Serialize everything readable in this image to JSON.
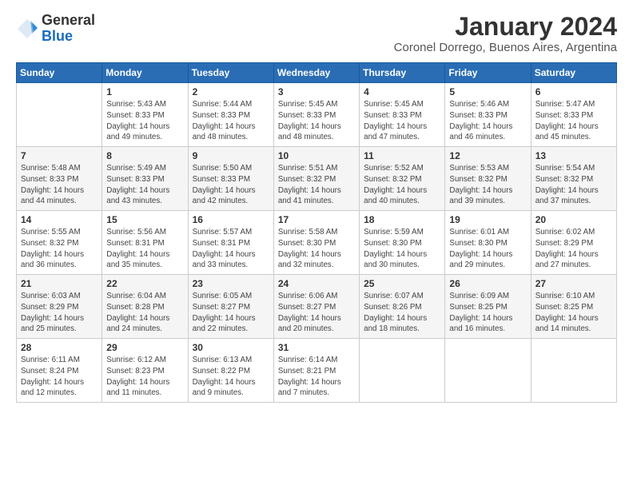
{
  "logo": {
    "general": "General",
    "blue": "Blue"
  },
  "title": "January 2024",
  "subtitle": "Coronel Dorrego, Buenos Aires, Argentina",
  "days_of_week": [
    "Sunday",
    "Monday",
    "Tuesday",
    "Wednesday",
    "Thursday",
    "Friday",
    "Saturday"
  ],
  "weeks": [
    [
      {
        "day": "",
        "info": ""
      },
      {
        "day": "1",
        "info": "Sunrise: 5:43 AM\nSunset: 8:33 PM\nDaylight: 14 hours\nand 49 minutes."
      },
      {
        "day": "2",
        "info": "Sunrise: 5:44 AM\nSunset: 8:33 PM\nDaylight: 14 hours\nand 48 minutes."
      },
      {
        "day": "3",
        "info": "Sunrise: 5:45 AM\nSunset: 8:33 PM\nDaylight: 14 hours\nand 48 minutes."
      },
      {
        "day": "4",
        "info": "Sunrise: 5:45 AM\nSunset: 8:33 PM\nDaylight: 14 hours\nand 47 minutes."
      },
      {
        "day": "5",
        "info": "Sunrise: 5:46 AM\nSunset: 8:33 PM\nDaylight: 14 hours\nand 46 minutes."
      },
      {
        "day": "6",
        "info": "Sunrise: 5:47 AM\nSunset: 8:33 PM\nDaylight: 14 hours\nand 45 minutes."
      }
    ],
    [
      {
        "day": "7",
        "info": "Sunrise: 5:48 AM\nSunset: 8:33 PM\nDaylight: 14 hours\nand 44 minutes."
      },
      {
        "day": "8",
        "info": "Sunrise: 5:49 AM\nSunset: 8:33 PM\nDaylight: 14 hours\nand 43 minutes."
      },
      {
        "day": "9",
        "info": "Sunrise: 5:50 AM\nSunset: 8:33 PM\nDaylight: 14 hours\nand 42 minutes."
      },
      {
        "day": "10",
        "info": "Sunrise: 5:51 AM\nSunset: 8:32 PM\nDaylight: 14 hours\nand 41 minutes."
      },
      {
        "day": "11",
        "info": "Sunrise: 5:52 AM\nSunset: 8:32 PM\nDaylight: 14 hours\nand 40 minutes."
      },
      {
        "day": "12",
        "info": "Sunrise: 5:53 AM\nSunset: 8:32 PM\nDaylight: 14 hours\nand 39 minutes."
      },
      {
        "day": "13",
        "info": "Sunrise: 5:54 AM\nSunset: 8:32 PM\nDaylight: 14 hours\nand 37 minutes."
      }
    ],
    [
      {
        "day": "14",
        "info": "Sunrise: 5:55 AM\nSunset: 8:32 PM\nDaylight: 14 hours\nand 36 minutes."
      },
      {
        "day": "15",
        "info": "Sunrise: 5:56 AM\nSunset: 8:31 PM\nDaylight: 14 hours\nand 35 minutes."
      },
      {
        "day": "16",
        "info": "Sunrise: 5:57 AM\nSunset: 8:31 PM\nDaylight: 14 hours\nand 33 minutes."
      },
      {
        "day": "17",
        "info": "Sunrise: 5:58 AM\nSunset: 8:30 PM\nDaylight: 14 hours\nand 32 minutes."
      },
      {
        "day": "18",
        "info": "Sunrise: 5:59 AM\nSunset: 8:30 PM\nDaylight: 14 hours\nand 30 minutes."
      },
      {
        "day": "19",
        "info": "Sunrise: 6:01 AM\nSunset: 8:30 PM\nDaylight: 14 hours\nand 29 minutes."
      },
      {
        "day": "20",
        "info": "Sunrise: 6:02 AM\nSunset: 8:29 PM\nDaylight: 14 hours\nand 27 minutes."
      }
    ],
    [
      {
        "day": "21",
        "info": "Sunrise: 6:03 AM\nSunset: 8:29 PM\nDaylight: 14 hours\nand 25 minutes."
      },
      {
        "day": "22",
        "info": "Sunrise: 6:04 AM\nSunset: 8:28 PM\nDaylight: 14 hours\nand 24 minutes."
      },
      {
        "day": "23",
        "info": "Sunrise: 6:05 AM\nSunset: 8:27 PM\nDaylight: 14 hours\nand 22 minutes."
      },
      {
        "day": "24",
        "info": "Sunrise: 6:06 AM\nSunset: 8:27 PM\nDaylight: 14 hours\nand 20 minutes."
      },
      {
        "day": "25",
        "info": "Sunrise: 6:07 AM\nSunset: 8:26 PM\nDaylight: 14 hours\nand 18 minutes."
      },
      {
        "day": "26",
        "info": "Sunrise: 6:09 AM\nSunset: 8:25 PM\nDaylight: 14 hours\nand 16 minutes."
      },
      {
        "day": "27",
        "info": "Sunrise: 6:10 AM\nSunset: 8:25 PM\nDaylight: 14 hours\nand 14 minutes."
      }
    ],
    [
      {
        "day": "28",
        "info": "Sunrise: 6:11 AM\nSunset: 8:24 PM\nDaylight: 14 hours\nand 12 minutes."
      },
      {
        "day": "29",
        "info": "Sunrise: 6:12 AM\nSunset: 8:23 PM\nDaylight: 14 hours\nand 11 minutes."
      },
      {
        "day": "30",
        "info": "Sunrise: 6:13 AM\nSunset: 8:22 PM\nDaylight: 14 hours\nand 9 minutes."
      },
      {
        "day": "31",
        "info": "Sunrise: 6:14 AM\nSunset: 8:21 PM\nDaylight: 14 hours\nand 7 minutes."
      },
      {
        "day": "",
        "info": ""
      },
      {
        "day": "",
        "info": ""
      },
      {
        "day": "",
        "info": ""
      }
    ]
  ]
}
